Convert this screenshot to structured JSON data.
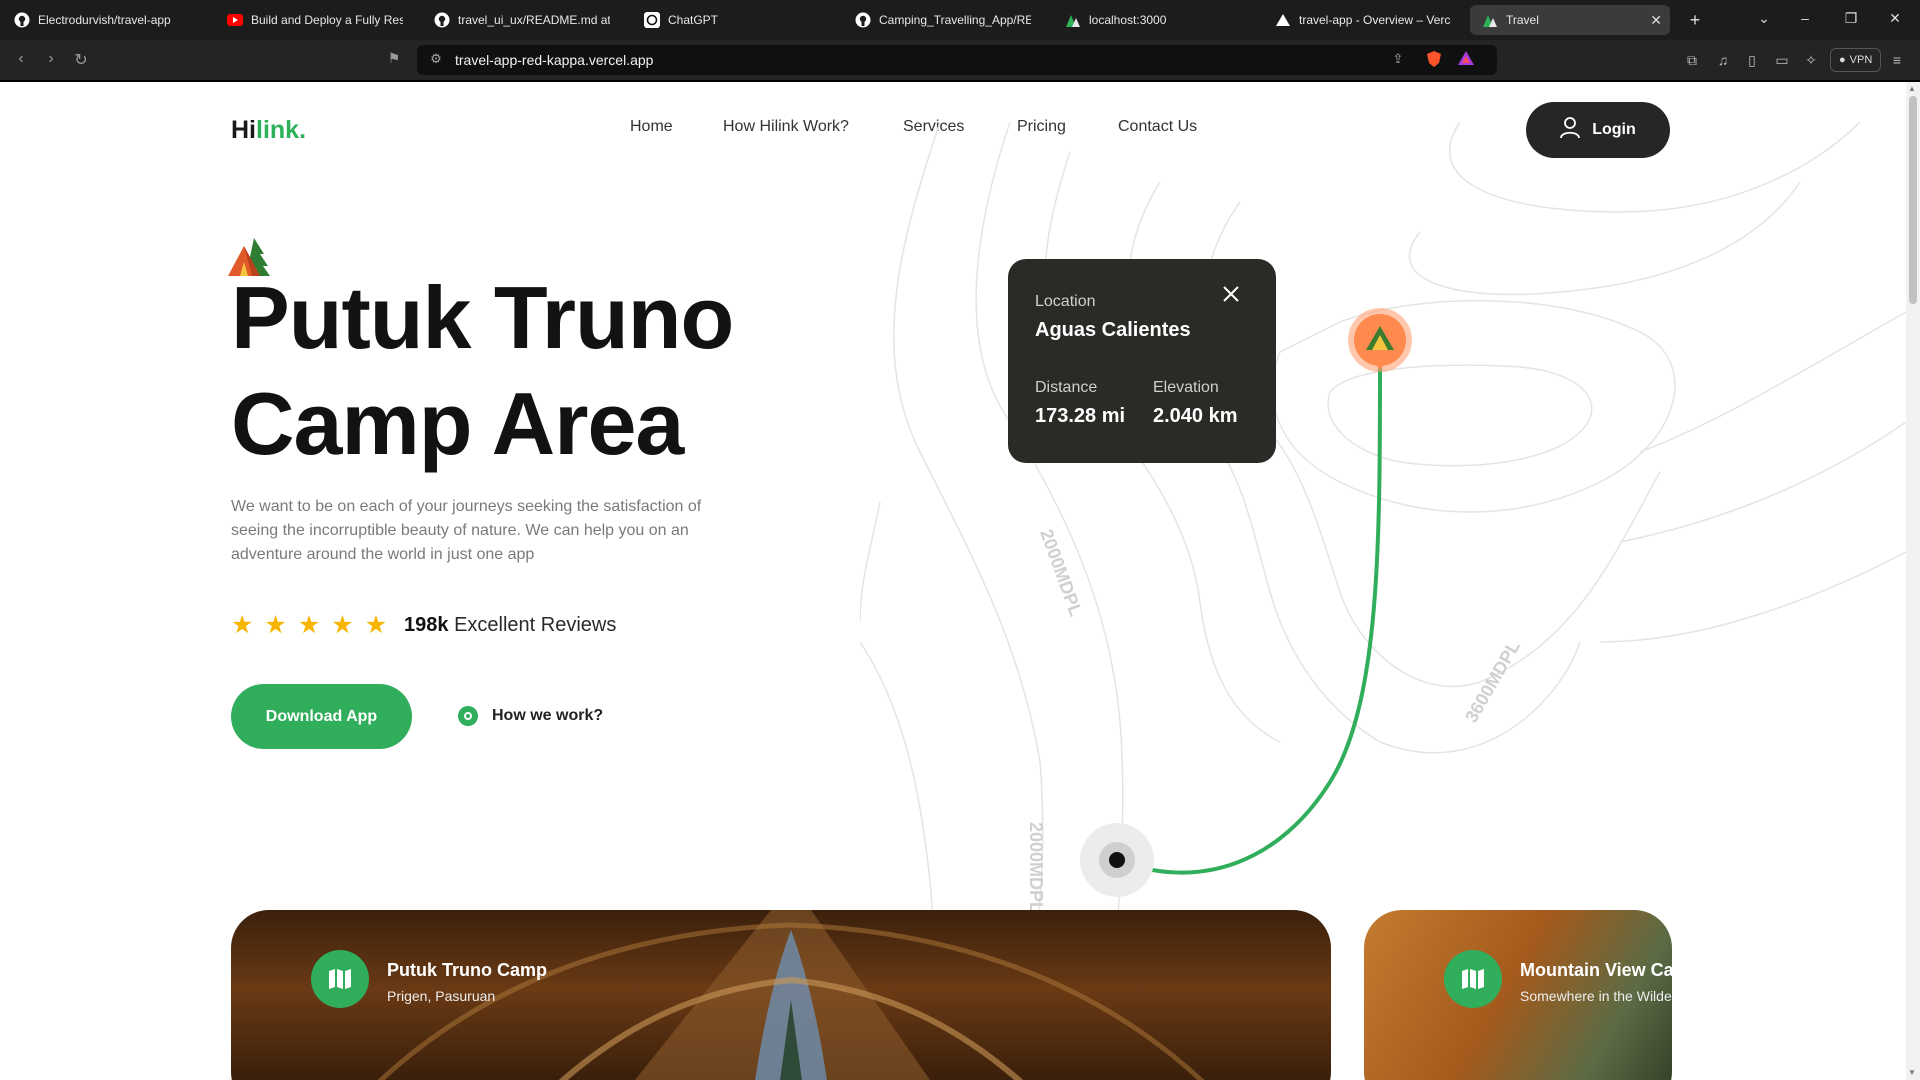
{
  "browser": {
    "tabs": [
      {
        "label": "Electrodurvish/travel-app",
        "icon": "github-icon"
      },
      {
        "label": "Build and Deploy a Fully Responsi",
        "icon": "youtube-icon"
      },
      {
        "label": "travel_ui_ux/README.md at m",
        "icon": "github-icon"
      },
      {
        "label": "ChatGPT",
        "icon": "chatgpt-icon"
      },
      {
        "label": "Camping_Travelling_App/REA",
        "icon": "github-icon"
      },
      {
        "label": "localhost:3000",
        "icon": "hilink-icon"
      },
      {
        "label": "travel-app - Overview – Vercel",
        "icon": "vercel-icon"
      },
      {
        "label": "Travel",
        "icon": "hilink-icon",
        "active": true
      }
    ],
    "url": "travel-app-red-kappa.vercel.app",
    "vpn_label": "VPN"
  },
  "header": {
    "logo_main": "Hi",
    "logo_accent": "link.",
    "nav": [
      "Home",
      "How Hilink Work?",
      "Services",
      "Pricing",
      "Contact Us"
    ],
    "login_label": "Login"
  },
  "hero": {
    "title_line1": "Putuk Truno",
    "title_line2": "Camp Area",
    "description": "We want to be on each of your journeys seeking the satisfaction of seeing the incorruptible beauty of nature. We can help you on an adventure around the world in just one app",
    "rating_stars": 5,
    "reviews_count": "198k",
    "reviews_label": "Excellent Reviews",
    "download_label": "Download App",
    "how_label": "How we work?"
  },
  "map": {
    "contour_labels": [
      "2000MDPL",
      "3600MDPL",
      "2000MDPL"
    ],
    "card": {
      "location_label": "Location",
      "location_value": "Aguas Calientes",
      "distance_label": "Distance",
      "distance_value": "173.28 mi",
      "elevation_label": "Elevation",
      "elevation_value": "2.040 km"
    }
  },
  "camps": [
    {
      "title": "Putuk Truno Camp",
      "subtitle": "Prigen, Pasuruan"
    },
    {
      "title": "Mountain View Camp",
      "subtitle": "Somewhere in the Wilderness"
    }
  ],
  "colors": {
    "accent": "#30ae5b",
    "dark": "#262624",
    "star": "#f7b500",
    "pin": "#ff8a50"
  }
}
